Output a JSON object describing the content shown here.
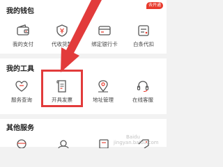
{
  "wallet": {
    "title": "我的钱包",
    "items": [
      {
        "label": "我的支付",
        "icon": "wallet-icon"
      },
      {
        "label": "代收货款",
        "icon": "yuan-shield-icon"
      },
      {
        "label": "绑定银行卡",
        "icon": "bank-card-icon"
      },
      {
        "label": "白条代扣",
        "icon": "ious-deduct-icon",
        "badge": "去开通"
      }
    ]
  },
  "tools": {
    "title": "我的工具",
    "items": [
      {
        "label": "服务查询",
        "icon": "service-query-icon"
      },
      {
        "label": "开具发票",
        "icon": "invoice-icon"
      },
      {
        "label": "地址管理",
        "icon": "location-pin-icon"
      },
      {
        "label": "在线客服",
        "icon": "headset-icon"
      }
    ]
  },
  "other": {
    "title": "其他服务"
  },
  "watermark": {
    "line1": "Baidu",
    "line2": "jingyan.baidu.com"
  },
  "colors": {
    "annotation": "#e23b3b",
    "badge": "#e8392b",
    "icon": "#555555"
  }
}
